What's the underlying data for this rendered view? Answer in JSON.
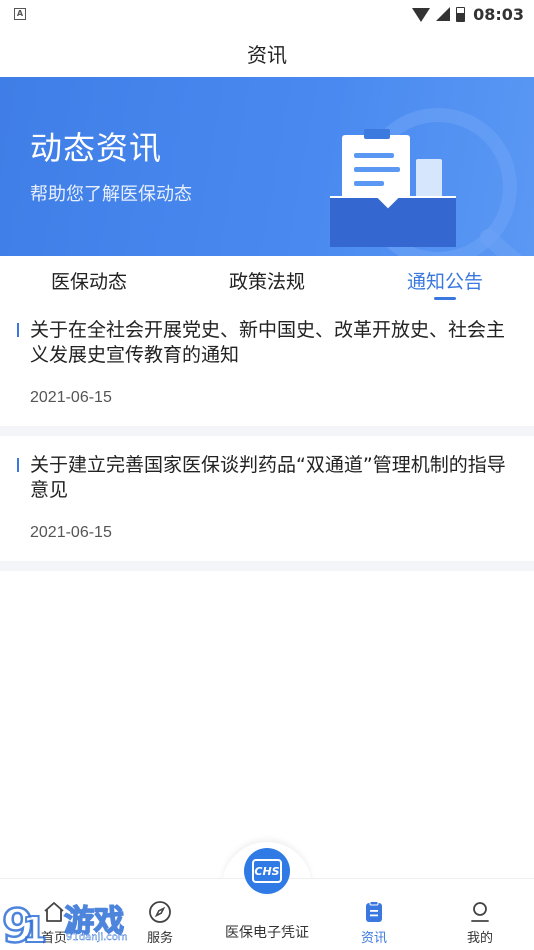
{
  "status_bar": {
    "time": "08:03",
    "notification_icon": "A"
  },
  "header": {
    "title": "资讯"
  },
  "banner": {
    "title": "动态资讯",
    "subtitle": "帮助您了解医保动态"
  },
  "tabs": [
    {
      "label": "医保动态",
      "active": false
    },
    {
      "label": "政策法规",
      "active": false
    },
    {
      "label": "通知公告",
      "active": true
    }
  ],
  "articles": [
    {
      "title": "关于在全社会开展党史、新中国史、改革开放史、社会主义发展史宣传教育的通知",
      "date": "2021-06-15"
    },
    {
      "title": "关于建立完善国家医保谈判药品“双通道”管理机制的指导意见",
      "date": "2021-06-15"
    }
  ],
  "bottom_nav": {
    "items": [
      {
        "label": "首页",
        "icon": "home-icon",
        "active": false
      },
      {
        "label": "服务",
        "icon": "compass-icon",
        "active": false
      },
      {
        "label": "医保电子凭证",
        "icon": "chs-logo-icon",
        "active": false
      },
      {
        "label": "资讯",
        "icon": "document-icon",
        "active": true
      },
      {
        "label": "我的",
        "icon": "user-icon",
        "active": false
      }
    ],
    "center_logo_text": "CHS"
  },
  "watermark": {
    "text": "游戏",
    "site": "91danji.com"
  },
  "colors": {
    "accent": "#3a78e0",
    "banner": "#4a8af0",
    "separator": "#f4f5f8"
  }
}
